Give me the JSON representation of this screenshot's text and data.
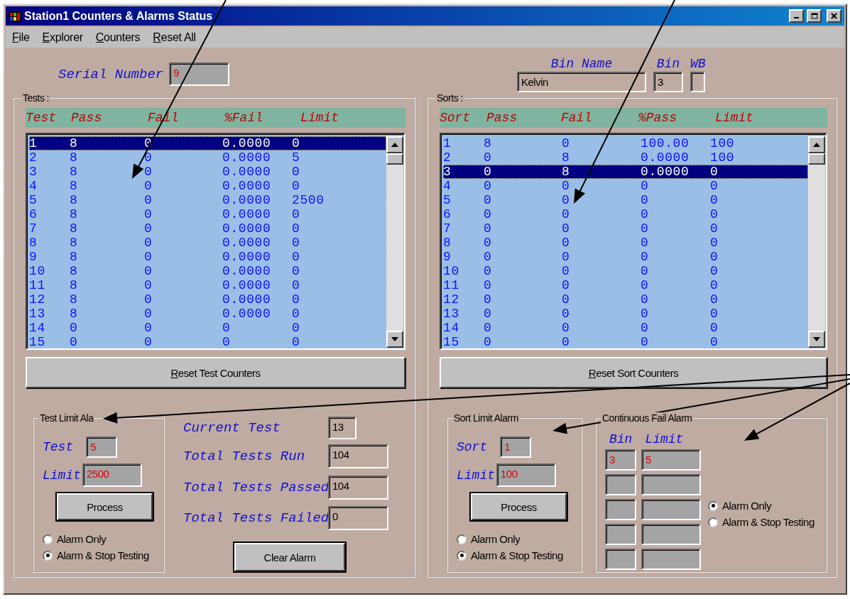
{
  "window": {
    "title": "Station1 Counters & Alarms Status"
  },
  "menu": [
    "File",
    "Explorer",
    "Counters",
    "Reset All"
  ],
  "serial_number": {
    "label": "Serial Number",
    "field": {
      "value": "9",
      "kind": "input"
    }
  },
  "bin": {
    "name_label": "Bin Name",
    "name_field": {
      "value": "Kelvin",
      "kind": "readout"
    },
    "bin_label": "Bin",
    "bin_field": {
      "value": "3",
      "kind": "readout"
    },
    "wb_label": "WB",
    "wb_field": {
      "kind": "readout"
    }
  },
  "tests": {
    "title": "Tests :",
    "columns": [
      "Test",
      "Pass",
      "Fail",
      "%Fail",
      "Limit"
    ],
    "rows": [
      {
        "cells": [
          "1",
          "8",
          "0",
          "0.0000",
          "0"
        ],
        "selected": true
      },
      {
        "cells": [
          "2",
          "8",
          "0",
          "0.0000",
          "5"
        ],
        "selected": false
      },
      {
        "cells": [
          "3",
          "8",
          "0",
          "0.0000",
          "0"
        ],
        "selected": false
      },
      {
        "cells": [
          "4",
          "8",
          "0",
          "0.0000",
          "0"
        ],
        "selected": false
      },
      {
        "cells": [
          "5",
          "8",
          "0",
          "0.0000",
          "2500"
        ],
        "selected": false
      },
      {
        "cells": [
          "6",
          "8",
          "0",
          "0.0000",
          "0"
        ],
        "selected": false
      },
      {
        "cells": [
          "7",
          "8",
          "0",
          "0.0000",
          "0"
        ],
        "selected": false
      },
      {
        "cells": [
          "8",
          "8",
          "0",
          "0.0000",
          "0"
        ],
        "selected": false
      },
      {
        "cells": [
          "9",
          "8",
          "0",
          "0.0000",
          "0"
        ],
        "selected": false
      },
      {
        "cells": [
          "10",
          "8",
          "0",
          "0.0000",
          "0"
        ],
        "selected": false
      },
      {
        "cells": [
          "11",
          "8",
          "0",
          "0.0000",
          "0"
        ],
        "selected": false
      },
      {
        "cells": [
          "12",
          "8",
          "0",
          "0.0000",
          "0"
        ],
        "selected": false
      },
      {
        "cells": [
          "13",
          "8",
          "0",
          "0.0000",
          "0"
        ],
        "selected": false
      },
      {
        "cells": [
          "14",
          "0",
          "0",
          "0",
          "0"
        ],
        "selected": false
      },
      {
        "cells": [
          "15",
          "0",
          "0",
          "0",
          "0"
        ],
        "selected": false
      }
    ],
    "button": "Reset Test Counters"
  },
  "test_limit_alarm": {
    "title": "Test Limit Ala",
    "fields": [
      {
        "label": "Test",
        "value": "5",
        "kind": "input"
      },
      {
        "label": "Limit",
        "value": "2500",
        "kind": "input"
      }
    ],
    "button": "Process",
    "options": [
      {
        "label": "Alarm Only",
        "selected": false
      },
      {
        "label": "Alarm & Stop Testing",
        "selected": true
      }
    ]
  },
  "stats": [
    {
      "label": "Current Test",
      "value": "13",
      "kind": "readout"
    },
    {
      "label": "Total Tests Run",
      "value": "104",
      "kind": "readout"
    },
    {
      "label": "Total Tests Passed",
      "value": "104",
      "kind": "readout"
    },
    {
      "label": "Total Tests Failed",
      "value": "0",
      "kind": "readout"
    }
  ],
  "clear_button": "Clear Alarm",
  "sorts": {
    "title": "Sorts :",
    "columns": [
      "Sort",
      "Pass",
      "Fail",
      "%Pass",
      "Limit"
    ],
    "rows": [
      {
        "cells": [
          "1",
          "8",
          "0",
          "100.00",
          "100"
        ],
        "selected": false
      },
      {
        "cells": [
          "2",
          "0",
          "8",
          "0.0000",
          "100"
        ],
        "selected": false
      },
      {
        "cells": [
          "3",
          "0",
          "8",
          "0.0000",
          "0"
        ],
        "selected": true
      },
      {
        "cells": [
          "4",
          "0",
          "0",
          "0",
          "0"
        ],
        "selected": false
      },
      {
        "cells": [
          "5",
          "0",
          "0",
          "0",
          "0"
        ],
        "selected": false
      },
      {
        "cells": [
          "6",
          "0",
          "0",
          "0",
          "0"
        ],
        "selected": false
      },
      {
        "cells": [
          "7",
          "0",
          "0",
          "0",
          "0"
        ],
        "selected": false
      },
      {
        "cells": [
          "8",
          "0",
          "0",
          "0",
          "0"
        ],
        "selected": false
      },
      {
        "cells": [
          "9",
          "0",
          "0",
          "0",
          "0"
        ],
        "selected": false
      },
      {
        "cells": [
          "10",
          "0",
          "0",
          "0",
          "0"
        ],
        "selected": false
      },
      {
        "cells": [
          "11",
          "0",
          "0",
          "0",
          "0"
        ],
        "selected": false
      },
      {
        "cells": [
          "12",
          "0",
          "0",
          "0",
          "0"
        ],
        "selected": false
      },
      {
        "cells": [
          "13",
          "0",
          "0",
          "0",
          "0"
        ],
        "selected": false
      },
      {
        "cells": [
          "14",
          "0",
          "0",
          "0",
          "0"
        ],
        "selected": false
      },
      {
        "cells": [
          "15",
          "0",
          "0",
          "0",
          "0"
        ],
        "selected": false
      }
    ],
    "button": "Reset Sort Counters"
  },
  "sort_limit_alarm": {
    "title": "Sort Limit Alarm",
    "fields": [
      {
        "label": "Sort",
        "value": "1",
        "kind": "input"
      },
      {
        "label": "Limit",
        "value": "100",
        "kind": "input"
      }
    ],
    "button": "Process",
    "options": [
      {
        "label": "Alarm Only",
        "selected": false
      },
      {
        "label": "Alarm & Stop Testing",
        "selected": true
      }
    ]
  },
  "continuous_fail_alarm": {
    "title": "Continuous Fail Alarm",
    "bin_label": "Bin",
    "limit_label": "Limit",
    "rows": [
      {
        "bin": "3",
        "limit": "5"
      },
      {},
      {},
      {},
      {}
    ],
    "options": [
      {
        "label": "Alarm Only",
        "selected": true
      },
      {
        "label": "Alarm & Stop Testing",
        "selected": false
      }
    ]
  }
}
